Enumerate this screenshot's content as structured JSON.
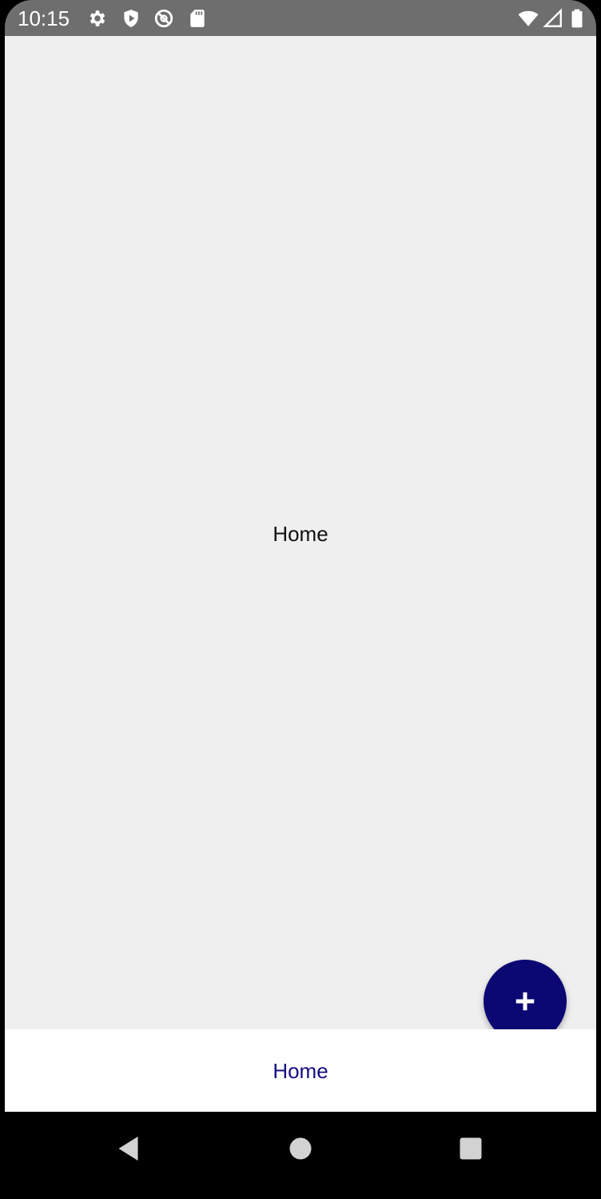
{
  "status_bar": {
    "time": "10:15",
    "left_icons": [
      "gear-icon",
      "shield-play-icon",
      "no-sync-icon",
      "sd-card-icon"
    ],
    "right_icons": [
      "wifi-icon",
      "cell-signal-icon",
      "battery-icon"
    ]
  },
  "main": {
    "title": "Home"
  },
  "fab": {
    "icon": "plus-icon",
    "color": "#0b0873"
  },
  "bottom_nav": {
    "items": [
      {
        "label": "Home",
        "color": "#140d80"
      }
    ]
  },
  "system_nav": {
    "buttons": [
      "back-icon",
      "home-icon",
      "recents-icon"
    ]
  }
}
